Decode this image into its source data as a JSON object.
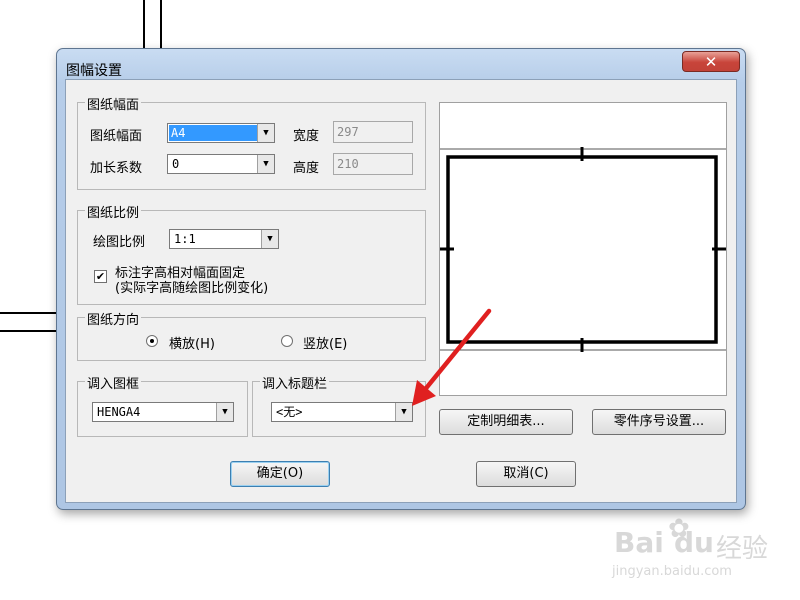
{
  "dialog": {
    "title": "图幅设置",
    "close_glyph": "✕"
  },
  "paper_group": {
    "legend": "图纸幅面",
    "size_label": "图纸幅面",
    "size_value": "A4",
    "extend_label": "加长系数",
    "extend_value": "0",
    "width_label": "宽度",
    "width_value": "297",
    "height_label": "高度",
    "height_value": "210"
  },
  "scale_group": {
    "legend": "图纸比例",
    "scale_label": "绘图比例",
    "scale_value": "1:1",
    "fixed_checked": true,
    "fixed_line1": "标注字高相对幅面固定",
    "fixed_line2": "(实际字高随绘图比例变化)"
  },
  "orientation_group": {
    "legend": "图纸方向",
    "landscape_label": "横放(H)",
    "portrait_label": "竖放(E)",
    "selected": "landscape"
  },
  "frame_group": {
    "legend": "调入图框",
    "value": "HENGA4"
  },
  "titlebar_group": {
    "legend": "调入标题栏",
    "value": "<无>"
  },
  "buttons": {
    "custom_list": "定制明细表...",
    "part_number": "零件序号设置...",
    "ok": "确定(O)",
    "cancel": "取消(C)"
  },
  "icons": {
    "dropdown": "▼",
    "check": "✔",
    "annotation": "red-arrow-icon"
  },
  "colors": {
    "selection": "#3399ff",
    "annotation_arrow": "#e02020",
    "close_button": "#c8443a"
  },
  "watermark": {
    "brand": "Bai",
    "brand2": "du",
    "jingyan": "经验",
    "url": "jingyan.baidu.com"
  }
}
